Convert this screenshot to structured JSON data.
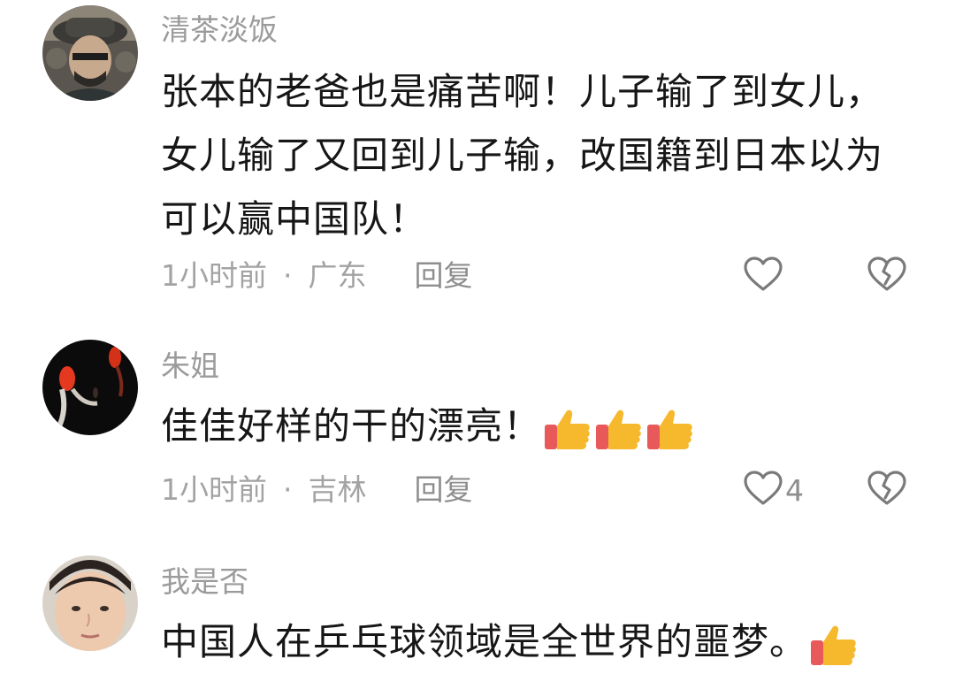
{
  "comments": [
    {
      "username": "清茶淡饭",
      "text": "张本的老爸也是痛苦啊！儿子输了到女儿，女儿输了又回到儿子输，改国籍到日本以为可以赢中国队！",
      "time": "1小时前",
      "separator": "·",
      "location": "广东",
      "reply_label": "回复",
      "like_count": "",
      "emoji_count": 0
    },
    {
      "username": "朱姐",
      "text": "佳佳好样的干的漂亮！",
      "time": "1小时前",
      "separator": "·",
      "location": "吉林",
      "reply_label": "回复",
      "like_count": "4",
      "emoji_count": 3
    },
    {
      "username": "我是否",
      "text": "中国人在乒乓球领域是全世界的噩梦。",
      "emoji_count": 1
    }
  ],
  "icons": {
    "like": "heart-outline-icon",
    "dislike": "broken-heart-icon",
    "emoji": "thumbs-up-emoji"
  },
  "colors": {
    "meta_text": "#a3a3a3",
    "username_text": "#9b9b9b",
    "icon_stroke": "#7a7a7a",
    "emoji_cuff": "#e85a5a",
    "emoji_hand": "#f6b82c"
  }
}
